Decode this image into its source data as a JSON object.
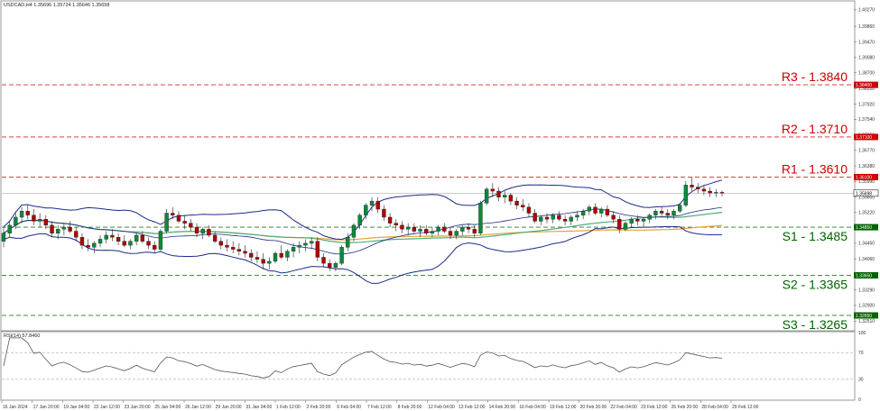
{
  "header": {
    "symbol_line": "USDCAD,H4  1.35696 1.35724 1.35646 1.35698",
    "rsi_line": "RSI(14) 57.8460"
  },
  "colors": {
    "resistance": "#cc0000",
    "support": "#006400",
    "candle_up": "#0a8a3a",
    "candle_down": "#b00000",
    "bollinger": "#1c2b8a",
    "ma_fast": "#4caf7a",
    "ma_slow": "#e6a23c",
    "rsi": "#555555"
  },
  "chart_data": {
    "type": "candlestick",
    "y_ticks": [
      "1.40270",
      "1.39860",
      "1.39470",
      "1.39080",
      "1.38700",
      "1.38310",
      "1.37920",
      "1.37540",
      "1.37150",
      "1.36770",
      "1.36380",
      "1.35990",
      "1.35600",
      "1.35220",
      "1.34830",
      "1.34450",
      "1.34060",
      "1.33670",
      "1.33290",
      "1.32900",
      "1.32510"
    ],
    "ylim": [
      1.3229,
      1.4047
    ],
    "x_ticks": [
      "16 Jan 2024",
      "17 Jan 20:00",
      "19 Jan 04:00",
      "22 Jan 12:00",
      "23 Jan 20:00",
      "25 Jan 04:00",
      "26 Jan 12:00",
      "29 Jan 20:00",
      "31 Jan 04:00",
      "1 Feb 12:00",
      "2 Feb 20:00",
      "6 Feb 04:00",
      "7 Feb 12:00",
      "8 Feb 20:00",
      "12 Feb 04:00",
      "13 Feb 12:00",
      "14 Feb 20:00",
      "16 Feb 04:00",
      "19 Feb 12:00",
      "20 Feb 20:00",
      "22 Feb 04:00",
      "23 Feb 12:00",
      "26 Feb 20:00",
      "28 Feb 04:00",
      "29 Feb 12:00"
    ],
    "current_price": {
      "value": 1.357,
      "label": "1.35698"
    },
    "levels": [
      {
        "name": "R3 - 1.3840",
        "value": 1.384,
        "tag": "1.38400",
        "kind": "resistance"
      },
      {
        "name": "R2 - 1.3710",
        "value": 1.371,
        "tag": "1.37100",
        "kind": "resistance"
      },
      {
        "name": "R1 - 1.3610",
        "value": 1.361,
        "tag": "1.36100",
        "kind": "resistance"
      },
      {
        "name": "S1 - 1.3485",
        "value": 1.3485,
        "tag": "1.34850",
        "kind": "support"
      },
      {
        "name": "S2 - 1.3365",
        "value": 1.3365,
        "tag": "1.33650",
        "kind": "support"
      },
      {
        "name": "S3 - 1.3265",
        "value": 1.3265,
        "tag": "1.32650",
        "kind": "support"
      }
    ],
    "candles": [
      [
        1.345,
        1.3485,
        1.3435,
        1.347
      ],
      [
        1.347,
        1.35,
        1.346,
        1.349
      ],
      [
        1.349,
        1.352,
        1.348,
        1.351
      ],
      [
        1.351,
        1.3535,
        1.3495,
        1.3525
      ],
      [
        1.3525,
        1.354,
        1.3505,
        1.3515
      ],
      [
        1.3515,
        1.353,
        1.349,
        1.35
      ],
      [
        1.35,
        1.352,
        1.3485,
        1.3505
      ],
      [
        1.3505,
        1.3515,
        1.348,
        1.349
      ],
      [
        1.349,
        1.35,
        1.346,
        1.347
      ],
      [
        1.347,
        1.349,
        1.3455,
        1.348
      ],
      [
        1.348,
        1.3495,
        1.3465,
        1.3485
      ],
      [
        1.3485,
        1.35,
        1.347,
        1.3475
      ],
      [
        1.3475,
        1.3485,
        1.345,
        1.346
      ],
      [
        1.346,
        1.347,
        1.343,
        1.344
      ],
      [
        1.344,
        1.3455,
        1.3425,
        1.3435
      ],
      [
        1.3435,
        1.345,
        1.342,
        1.3445
      ],
      [
        1.3445,
        1.3465,
        1.3435,
        1.3455
      ],
      [
        1.3455,
        1.3475,
        1.3445,
        1.3465
      ],
      [
        1.3465,
        1.348,
        1.345,
        1.346
      ],
      [
        1.346,
        1.347,
        1.344,
        1.345
      ],
      [
        1.345,
        1.3465,
        1.3435,
        1.344
      ],
      [
        1.344,
        1.3455,
        1.343,
        1.345
      ],
      [
        1.345,
        1.347,
        1.344,
        1.3465
      ],
      [
        1.3465,
        1.3475,
        1.3445,
        1.345
      ],
      [
        1.345,
        1.346,
        1.343,
        1.344
      ],
      [
        1.344,
        1.345,
        1.342,
        1.343
      ],
      [
        1.343,
        1.348,
        1.3425,
        1.3475
      ],
      [
        1.3475,
        1.353,
        1.347,
        1.352
      ],
      [
        1.352,
        1.3535,
        1.3505,
        1.3515
      ],
      [
        1.3515,
        1.3525,
        1.3495,
        1.35
      ],
      [
        1.35,
        1.3515,
        1.348,
        1.3495
      ],
      [
        1.3495,
        1.3505,
        1.3475,
        1.3485
      ],
      [
        1.3485,
        1.3495,
        1.346,
        1.347
      ],
      [
        1.347,
        1.3485,
        1.3455,
        1.348
      ],
      [
        1.348,
        1.349,
        1.346,
        1.3465
      ],
      [
        1.3465,
        1.3475,
        1.3445,
        1.345
      ],
      [
        1.345,
        1.346,
        1.343,
        1.344
      ],
      [
        1.344,
        1.3455,
        1.3425,
        1.3435
      ],
      [
        1.3435,
        1.345,
        1.342,
        1.343
      ],
      [
        1.343,
        1.3445,
        1.3415,
        1.3425
      ],
      [
        1.3425,
        1.344,
        1.341,
        1.342
      ],
      [
        1.342,
        1.343,
        1.34,
        1.341
      ],
      [
        1.341,
        1.3425,
        1.3395,
        1.3405
      ],
      [
        1.3405,
        1.342,
        1.338,
        1.3395
      ],
      [
        1.3395,
        1.341,
        1.338,
        1.34
      ],
      [
        1.34,
        1.3425,
        1.3395,
        1.342
      ],
      [
        1.342,
        1.344,
        1.3405,
        1.341
      ],
      [
        1.341,
        1.343,
        1.34,
        1.3425
      ],
      [
        1.3425,
        1.3445,
        1.341,
        1.3435
      ],
      [
        1.3435,
        1.345,
        1.342,
        1.344
      ],
      [
        1.344,
        1.3455,
        1.3425,
        1.3445
      ],
      [
        1.3445,
        1.346,
        1.343,
        1.345
      ],
      [
        1.345,
        1.346,
        1.34,
        1.341
      ],
      [
        1.341,
        1.342,
        1.3385,
        1.3395
      ],
      [
        1.3395,
        1.3405,
        1.3375,
        1.3385
      ],
      [
        1.3385,
        1.34,
        1.3375,
        1.3395
      ],
      [
        1.3395,
        1.344,
        1.339,
        1.3435
      ],
      [
        1.3435,
        1.347,
        1.3425,
        1.346
      ],
      [
        1.346,
        1.3495,
        1.345,
        1.349
      ],
      [
        1.349,
        1.352,
        1.348,
        1.3515
      ],
      [
        1.3515,
        1.3545,
        1.3505,
        1.354
      ],
      [
        1.354,
        1.356,
        1.3525,
        1.355
      ],
      [
        1.355,
        1.356,
        1.352,
        1.353
      ],
      [
        1.353,
        1.354,
        1.35,
        1.351
      ],
      [
        1.351,
        1.352,
        1.3485,
        1.3495
      ],
      [
        1.3495,
        1.3505,
        1.3475,
        1.349
      ],
      [
        1.349,
        1.35,
        1.347,
        1.348
      ],
      [
        1.348,
        1.3495,
        1.3465,
        1.3485
      ],
      [
        1.3485,
        1.3495,
        1.347,
        1.3475
      ],
      [
        1.3475,
        1.349,
        1.346,
        1.348
      ],
      [
        1.348,
        1.349,
        1.3465,
        1.347
      ],
      [
        1.347,
        1.3485,
        1.346,
        1.3475
      ],
      [
        1.3475,
        1.349,
        1.3465,
        1.3485
      ],
      [
        1.3485,
        1.3495,
        1.347,
        1.3475
      ],
      [
        1.3475,
        1.3485,
        1.3455,
        1.3465
      ],
      [
        1.3465,
        1.348,
        1.3455,
        1.3475
      ],
      [
        1.3475,
        1.349,
        1.3465,
        1.3485
      ],
      [
        1.3485,
        1.3495,
        1.347,
        1.348
      ],
      [
        1.348,
        1.349,
        1.346,
        1.347
      ],
      [
        1.347,
        1.355,
        1.3465,
        1.3545
      ],
      [
        1.3545,
        1.3585,
        1.354,
        1.358
      ],
      [
        1.358,
        1.3595,
        1.356,
        1.3575
      ],
      [
        1.3575,
        1.3585,
        1.355,
        1.356
      ],
      [
        1.356,
        1.3575,
        1.3545,
        1.3565
      ],
      [
        1.3565,
        1.357,
        1.354,
        1.355
      ],
      [
        1.355,
        1.356,
        1.353,
        1.354
      ],
      [
        1.354,
        1.3555,
        1.3525,
        1.3535
      ],
      [
        1.3535,
        1.3545,
        1.351,
        1.352
      ],
      [
        1.352,
        1.353,
        1.3495,
        1.35
      ],
      [
        1.35,
        1.3515,
        1.349,
        1.351
      ],
      [
        1.351,
        1.352,
        1.3495,
        1.3505
      ],
      [
        1.3505,
        1.352,
        1.3495,
        1.3515
      ],
      [
        1.3515,
        1.3525,
        1.35,
        1.3505
      ],
      [
        1.3505,
        1.3515,
        1.349,
        1.35
      ],
      [
        1.35,
        1.3515,
        1.349,
        1.351
      ],
      [
        1.351,
        1.3525,
        1.35,
        1.3515
      ],
      [
        1.3515,
        1.353,
        1.3505,
        1.3525
      ],
      [
        1.3525,
        1.354,
        1.3515,
        1.3535
      ],
      [
        1.3535,
        1.3545,
        1.3515,
        1.352
      ],
      [
        1.352,
        1.3535,
        1.351,
        1.353
      ],
      [
        1.353,
        1.354,
        1.351,
        1.3515
      ],
      [
        1.3515,
        1.3525,
        1.3495,
        1.3505
      ],
      [
        1.3505,
        1.3515,
        1.347,
        1.348
      ],
      [
        1.348,
        1.35,
        1.3475,
        1.3495
      ],
      [
        1.3495,
        1.351,
        1.3485,
        1.3505
      ],
      [
        1.3505,
        1.3515,
        1.349,
        1.35
      ],
      [
        1.35,
        1.351,
        1.3485,
        1.3505
      ],
      [
        1.3505,
        1.352,
        1.3495,
        1.3515
      ],
      [
        1.3515,
        1.353,
        1.3505,
        1.3525
      ],
      [
        1.3525,
        1.3535,
        1.351,
        1.352
      ],
      [
        1.352,
        1.353,
        1.3505,
        1.3515
      ],
      [
        1.3515,
        1.353,
        1.3505,
        1.3525
      ],
      [
        1.3525,
        1.3545,
        1.352,
        1.354
      ],
      [
        1.354,
        1.36,
        1.3535,
        1.359
      ],
      [
        1.359,
        1.361,
        1.3575,
        1.3585
      ],
      [
        1.3585,
        1.3595,
        1.357,
        1.358
      ],
      [
        1.358,
        1.359,
        1.3565,
        1.3575
      ],
      [
        1.3575,
        1.3585,
        1.356,
        1.357
      ],
      [
        1.357,
        1.358,
        1.356,
        1.3572
      ],
      [
        1.3572,
        1.3576,
        1.3562,
        1.357
      ]
    ],
    "bb_period": 20,
    "ma_fast_period": 50,
    "ma_slow_period": 100,
    "rsi_ticks": [
      "100",
      "70",
      "30",
      "0"
    ],
    "rsi_ylim": [
      0,
      100
    ]
  }
}
